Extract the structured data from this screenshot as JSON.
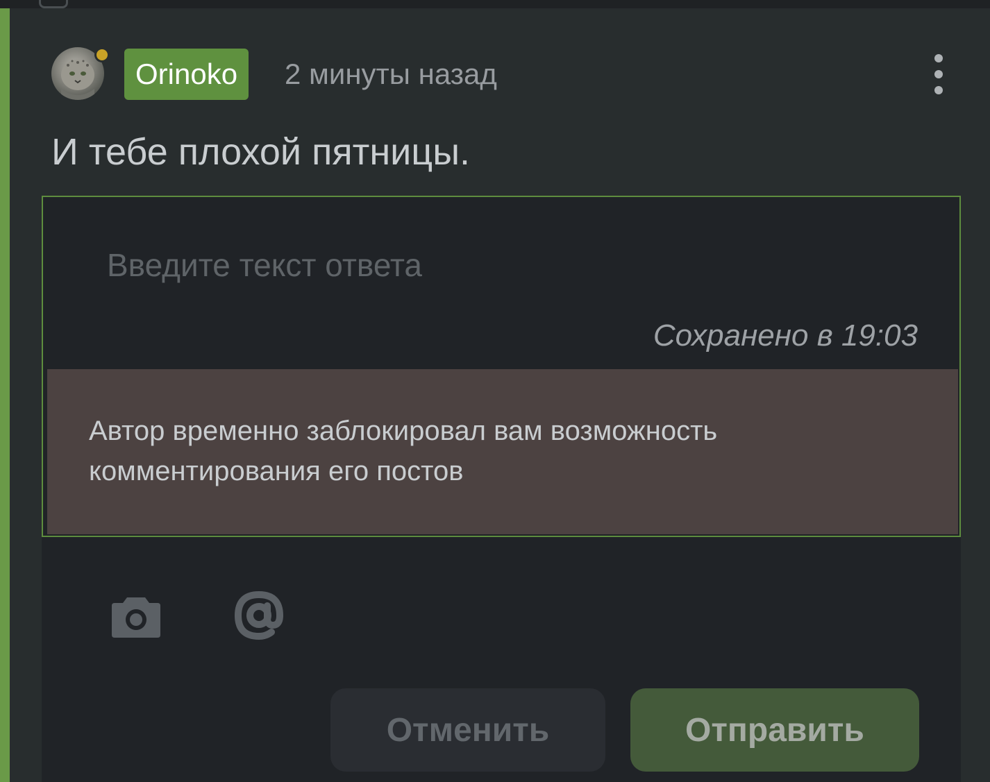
{
  "comment": {
    "author": "Orinoko",
    "timestamp": "2 минуты назад",
    "text": "И тебе плохой пятницы.",
    "author_online": true,
    "avatar_icon": "avatar-icon",
    "more_icon": "more-vertical-icon"
  },
  "reply": {
    "placeholder": "Введите текст ответа",
    "value": "",
    "saved_status": "Сохранено в 19:03",
    "blocked_notice": "Автор временно заблокировал вам возможность комментирования его постов",
    "toolbar": {
      "camera_icon": "camera-icon",
      "mention_icon": "at-icon"
    },
    "cancel_label": "Отменить",
    "send_label": "Отправить"
  },
  "colors": {
    "accent": "#5f913f",
    "status_dot": "#c9a227",
    "notice_bg": "#4c4241",
    "background": "#282d2e"
  }
}
